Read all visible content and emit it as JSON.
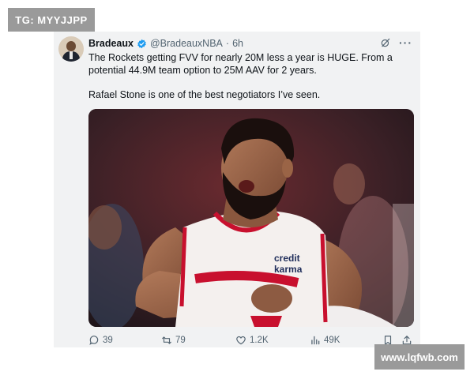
{
  "watermarks": {
    "top_left": "TG: MYYJJPP",
    "bottom_right": "www.lqfwb.com"
  },
  "tweet": {
    "author_name": "Bradeaux",
    "handle": "@BradeauxNBA",
    "separator": "·",
    "time": "6h",
    "text_lines": [
      "The Rockets getting FVV for nearly 20M less a year is HUGE. From a potential 44.9M team option to 25M AAV for 2 years.",
      "Rafael Stone is one of the best negotiators I’ve seen."
    ],
    "media_jersey_text": "credit karma",
    "actions": {
      "replies": "39",
      "retweets": "79",
      "likes": "1.2K",
      "views": "49K"
    }
  },
  "colors": {
    "accent": "#1d9bf0",
    "jersey": "#f4f0ee",
    "jersey_trim": "#c8102e"
  },
  "icons": [
    "verified-badge-icon",
    "grok-icon",
    "more-icon",
    "reply-icon",
    "retweet-icon",
    "like-icon",
    "views-icon",
    "bookmark-icon",
    "share-icon"
  ]
}
